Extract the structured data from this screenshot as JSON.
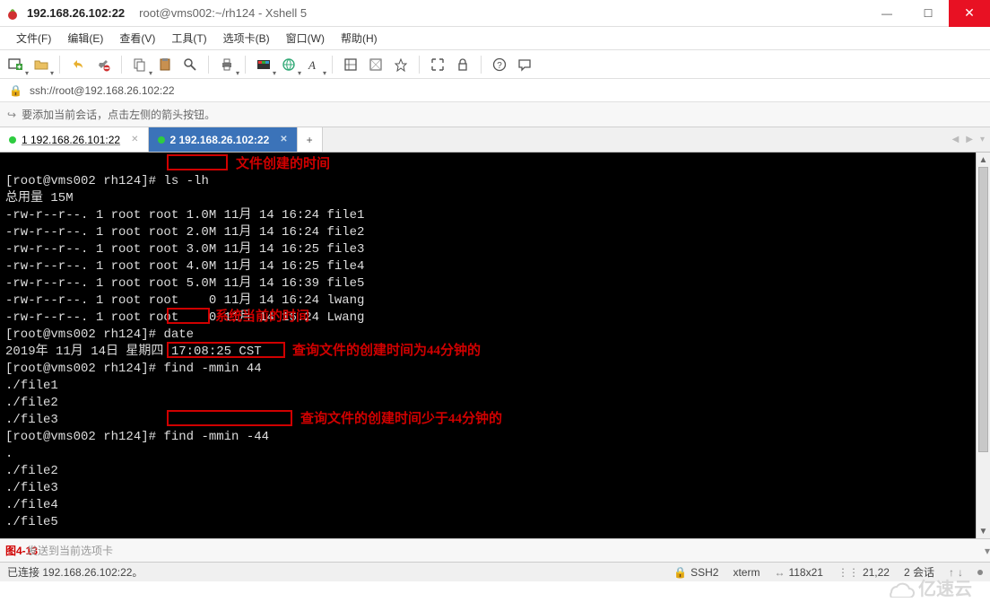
{
  "titlebar": {
    "main": "192.168.26.102:22",
    "sub": "root@vms002:~/rh124 - Xshell 5"
  },
  "menu": {
    "file": "文件(F)",
    "edit": "编辑(E)",
    "view": "查看(V)",
    "tools": "工具(T)",
    "tabs": "选项卡(B)",
    "window": "窗口(W)",
    "help": "帮助(H)"
  },
  "address": {
    "url": "ssh://root@192.168.26.102:22"
  },
  "hint": {
    "text": "要添加当前会话，点击左侧的箭头按钮。"
  },
  "tabs": {
    "t1": {
      "label": "1 192.168.26.101:22"
    },
    "t2": {
      "label": "2 192.168.26.102:22"
    }
  },
  "terminal": {
    "line1_prompt": "[root@vms002 rh124]# ",
    "line1_cmd": "ls -lh",
    "line2": "总用量 15M",
    "line3": "-rw-r--r--. 1 root root 1.0M 11月 14 16:24 file1",
    "line4": "-rw-r--r--. 1 root root 2.0M 11月 14 16:24 file2",
    "line5": "-rw-r--r--. 1 root root 3.0M 11月 14 16:25 file3",
    "line6": "-rw-r--r--. 1 root root 4.0M 11月 14 16:25 file4",
    "line7": "-rw-r--r--. 1 root root 5.0M 11月 14 16:39 file5",
    "line8": "-rw-r--r--. 1 root root    0 11月 14 16:24 lwang",
    "line9": "-rw-r--r--. 1 root root    0 11月 14 16:24 Lwang",
    "line10_prompt": "[root@vms002 rh124]# ",
    "line10_cmd": "date",
    "line11": "2019年 11月 14日 星期四 17:08:25 CST",
    "line12_prompt": "[root@vms002 rh124]# ",
    "line12_cmd": "find -mmin 44",
    "line13": "./file1",
    "line14": "./file2",
    "line15": "./file3",
    "line16_prompt": "[root@vms002 rh124]# ",
    "line16_cmd": "find -mmin -44",
    "line17": ".",
    "line18": "./file2",
    "line19": "./file3",
    "line20": "./file4",
    "line21": "./file5"
  },
  "annotations": {
    "a1": "文件创建的时间",
    "a2": "系统当前的时间",
    "a3": "查询文件的创建时间为44分钟的",
    "a4": "查询文件的创建时间少于44分钟的"
  },
  "sendbar": {
    "fig": "图4-13",
    "hint": "发送到当前选项卡"
  },
  "statusbar": {
    "conn": "已连接 192.168.26.102:22。",
    "proto": "SSH2",
    "termtype": "xterm",
    "size": "118x21",
    "pos": "21,22",
    "sessions": "2 会话"
  },
  "watermark": {
    "text": "亿速云"
  },
  "icons": {
    "newtab": "newtab",
    "open": "open",
    "reconnect": "reconnect",
    "disconnect": "disconnect",
    "copy": "copy",
    "paste": "paste",
    "find": "find",
    "print": "print",
    "color": "color",
    "globe": "globe",
    "font": "font",
    "fullscreen": "fullscreen",
    "transparent": "transparent",
    "ontop": "ontop",
    "scrolllock": "scrolllock",
    "lock": "lock",
    "help": "help",
    "tile": "tile"
  }
}
